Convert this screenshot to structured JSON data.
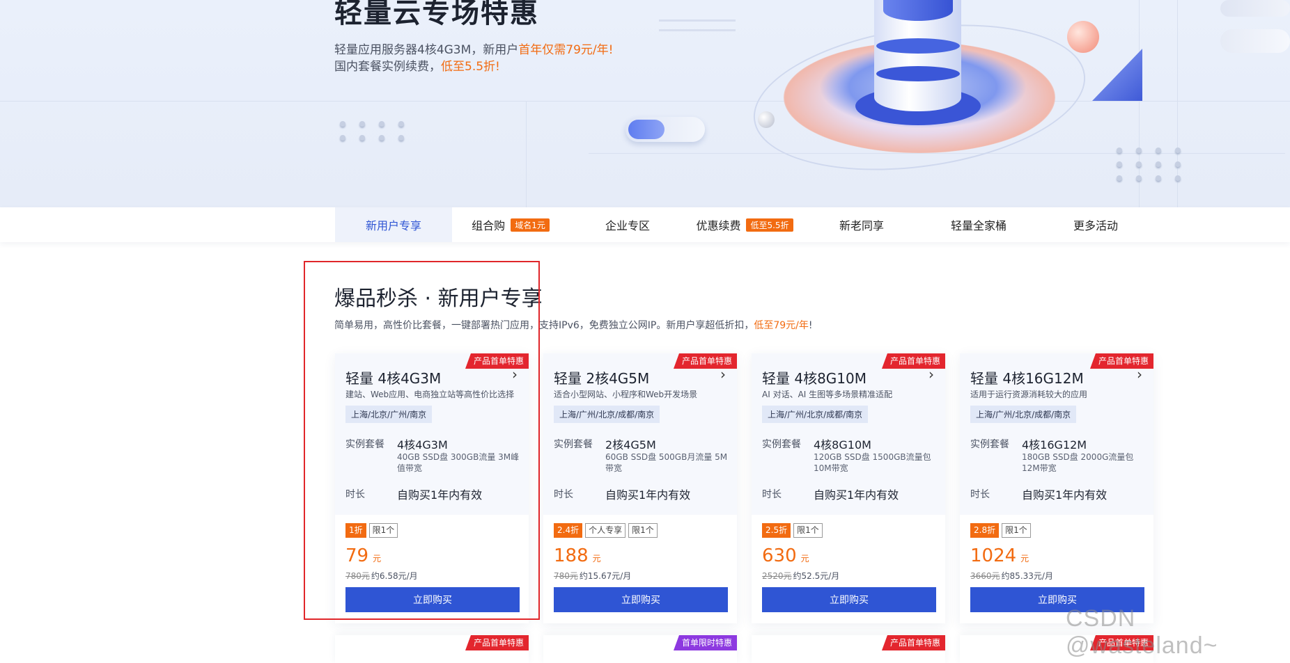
{
  "hero": {
    "title": "轻量云专场特惠",
    "line1_prefix": "轻量应用服务器4核4G3M，新用户",
    "line1_highlight": "首年仅需79元/年!",
    "line2_prefix": "国内套餐实例续费，",
    "line2_highlight": "低至5.5折!"
  },
  "tabs": [
    {
      "label": "新用户专享",
      "badge": "",
      "active": true
    },
    {
      "label": "组合购",
      "badge": "域名1元",
      "active": false
    },
    {
      "label": "企业专区",
      "badge": "",
      "active": false
    },
    {
      "label": "优惠续费",
      "badge": "低至5.5折",
      "active": false
    },
    {
      "label": "新老同享",
      "badge": "",
      "active": false
    },
    {
      "label": "轻量全家桶",
      "badge": "",
      "active": false
    },
    {
      "label": "更多活动",
      "badge": "",
      "active": false
    }
  ],
  "section": {
    "title": "爆品秒杀 · 新用户专享",
    "desc_prefix": "简单易用，高性价比套餐，一键部署热门应用，支持IPv6，免费独立公网IP。新用户享超低折扣，",
    "desc_highlight": "低至79元/年",
    "desc_suffix": "!"
  },
  "labels": {
    "spec": "实例套餐",
    "duration": "时长",
    "buy": "立即购买",
    "price_unit": "元"
  },
  "cards": [
    {
      "ribbon": "产品首单特惠",
      "name": "轻量 4核4G3M",
      "sub": "建站、Web应用、电商独立站等高性价比选择",
      "region": "上海/北京/广州/南京",
      "spec": "4核4G3M",
      "spec_desc": "40GB SSD盘 300GB流量 3M峰值带宽",
      "duration": "自购买1年内有效",
      "tags": [
        "1折",
        "限1个"
      ],
      "price": "79",
      "orig_price": "780元",
      "monthly": "约6.58元/月"
    },
    {
      "ribbon": "产品首单特惠",
      "name": "轻量 2核4G5M",
      "sub": "适合小型网站、小程序和Web开发场景",
      "region": "上海/广州/北京/成都/南京",
      "spec": "2核4G5M",
      "spec_desc": "60GB SSD盘 500GB月流量 5M带宽",
      "duration": "自购买1年内有效",
      "tags": [
        "2.4折",
        "个人专享",
        "限1个"
      ],
      "price": "188",
      "orig_price": "780元",
      "monthly": "约15.67元/月"
    },
    {
      "ribbon": "产品首单特惠",
      "name": "轻量 4核8G10M",
      "sub": "AI 对话、AI 生图等多场景精准适配",
      "region": "上海/广州/北京/成都/南京",
      "spec": "4核8G10M",
      "spec_desc": "120GB SSD盘 1500GB流量包 10M带宽",
      "duration": "自购买1年内有效",
      "tags": [
        "2.5折",
        "限1个"
      ],
      "price": "630",
      "orig_price": "2520元",
      "monthly": "约52.5元/月"
    },
    {
      "ribbon": "产品首单特惠",
      "name": "轻量 4核16G12M",
      "sub": "适用于运行资源消耗较大的应用",
      "region": "上海/广州/北京/成都/南京",
      "spec": "4核16G12M",
      "spec_desc": "180GB SSD盘 2000G流量包 12M带宽",
      "duration": "自购买1年内有效",
      "tags": [
        "2.8折",
        "限1个"
      ],
      "price": "1024",
      "orig_price": "3660元",
      "monthly": "约85.33元/月"
    }
  ],
  "next_row_ribbons": [
    "产品首单特惠",
    "首单限时特惠",
    "产品首单特惠",
    "产品首单特惠"
  ],
  "watermark": "CSDN @wasteland~",
  "colors": {
    "accent": "#2f55d4",
    "highlight": "#f26b11",
    "ribbon_red": "#e3262e",
    "ribbon_purple": "#8d39e0",
    "annotation_box": "#e0262a"
  }
}
